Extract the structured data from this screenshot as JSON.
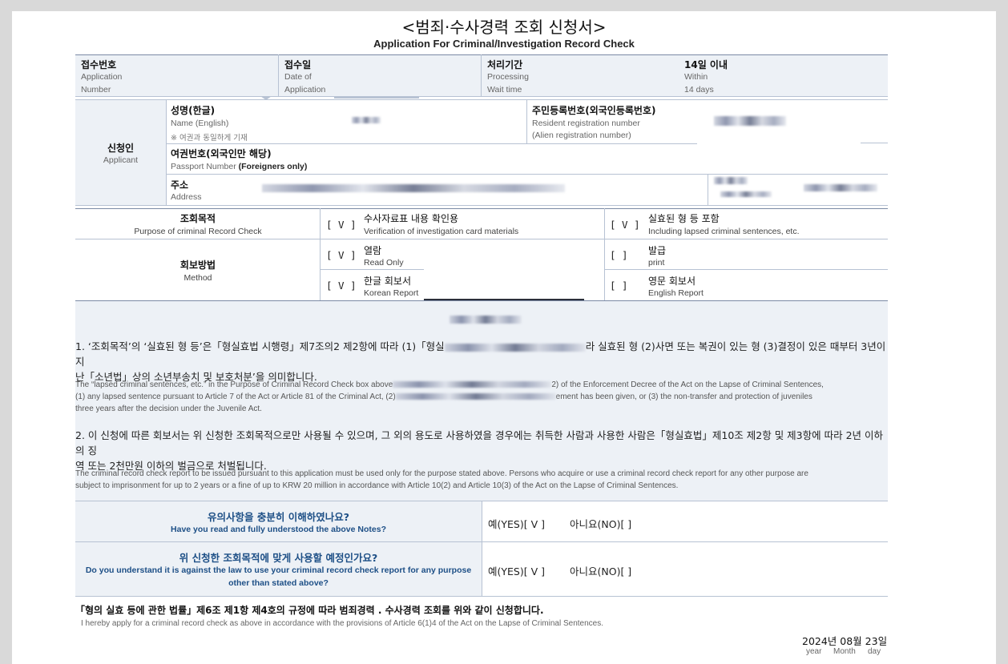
{
  "title": "<범죄·수사경력 조회 신청서>",
  "subtitle": "Application For Criminal/Investigation Record Check",
  "header": {
    "receipt_no_ko": "접수번호",
    "receipt_no_en1": "Application",
    "receipt_no_en2": "Number",
    "date_ko": "접수일",
    "date_en1": "Date of",
    "date_en2": "Application",
    "period_ko": "처리기간",
    "period_en1": "Processing",
    "period_en2": "Wait time",
    "period_value_ko": "14일 이내",
    "period_value_en1": "Within",
    "period_value_en2": "14 days"
  },
  "applicant": {
    "label_ko": "신청인",
    "label_en": "Applicant",
    "name_ko": "성명(한글)",
    "name_en": "Name (English)",
    "name_note": "※ 여권과 동일하게 기재",
    "rrn_ko": "주민등록번호(외국인등록번호)",
    "rrn_en1": "Resident registration number",
    "rrn_en2": "(Alien registration number)",
    "passport_ko": "여권번호(외국인만 해당)",
    "passport_en": "Passport Number",
    "passport_en_bold": "(Foreigners only)",
    "address_ko": "주소",
    "address_en": "Address"
  },
  "purpose": {
    "label_ko": "조회목적",
    "label_en": "Purpose of criminal Record Check",
    "opt1_check": "[ V ]",
    "opt1_ko": "수사자료표 내용 확인용",
    "opt1_en": "Verification of investigation card materials",
    "opt2_check": "[ V ]",
    "opt2_ko": "실효된 형 등 포함",
    "opt2_en": "Including lapsed criminal sentences, etc."
  },
  "method": {
    "label_ko": "회보방법",
    "label_en": "Method",
    "read_check": "[ V ]",
    "read_ko": "열람",
    "read_en": "Read Only",
    "print_check": "[   ]",
    "print_ko": "발급",
    "print_en": "print",
    "korean_check": "[ V ]",
    "korean_ko": "한글 회보서",
    "korean_en": "Korean Report",
    "english_check": "[   ]",
    "english_ko": "영문 회보서",
    "english_en": "English Report"
  },
  "notes": {
    "n1_ko_a": "1. ‘조회목적’의 ‘실효된 형 등’은「형실효법 시행령」제7조의2 제2항에 따라 (1)「형실",
    "n1_ko_b": "라 실효된 형 (2)사면 또는 복권이 있는 형 (3)결정이 있은 때부터 3년이 지",
    "n1_ko_c": "난「소년법」상의 소년부송치 및 보호처분’을 의미합니다.",
    "n1_en_a": "The “lapsed criminal sentences, etc.” in the Purpose of Criminal Record Check box above",
    "n1_en_b": "2) of the Enforcement Decree of the Act on the Lapse of Criminal Sentences,",
    "n1_en_c": "(1) any lapsed sentence pursuant to Article 7 of the Act or Article 81 of the Criminal Act, (2)",
    "n1_en_d": "ement has been given, or (3) the non-transfer and protection of juveniles",
    "n1_en_e": "three years after the decision under the Juvenile Act.",
    "n2_ko_a": "2. 이 신청에 따른 회보서는 위 신청한 조회목적으로만 사용될 수 있으며, 그 외의 용도로 사용하였을 경우에는 취득한 사람과 사용한 사람은「형실효법」제10조 제2항 및 제3항에 따라 2년 이하의 징",
    "n2_ko_b": "역 또는 2천만원 이하의 벌금으로 처벌됩니다.",
    "n2_en_a": "The criminal record check report to be issued pursuant to this application must be used only for the purpose stated above. Persons who acquire or use a criminal record check report for any other purpose are",
    "n2_en_b": "subject to imprisonment for up to 2 years or a fine of up to KRW 20 million in accordance with Article 10(2) and Article 10(3) of the Act on the Lapse of Criminal Sentences."
  },
  "questions": {
    "q1_ko": "유의사항을 충분히 이해하였나요?",
    "q1_en": "Have you read and fully understood the above Notes?",
    "q1_yes": "예(YES)[ V ]",
    "q1_no": "아니요(NO)[   ]",
    "q2_ko": "위 신청한 조회목적에 맞게 사용할 예정인가요?",
    "q2_en1": "Do you understand it is against the law to use your criminal record check report for any purpose",
    "q2_en2": "other than stated above?",
    "q2_yes": "예(YES)[ V ]",
    "q2_no": "아니요(NO)[   ]"
  },
  "declaration": {
    "ko": "「형의 실효 등에 관한 법률」제6조 제1항 제4호의 규정에 따라 범죄경력 . 수사경력 조회를 위와 같이 신청합니다.",
    "en": "I hereby apply for a criminal record check as above in accordance with the provisions of Article 6(1)4 of the Act on the Lapse of Criminal Sentences.",
    "date": "2024년 08월 23일",
    "year": "year",
    "month": "Month",
    "day": "day"
  }
}
